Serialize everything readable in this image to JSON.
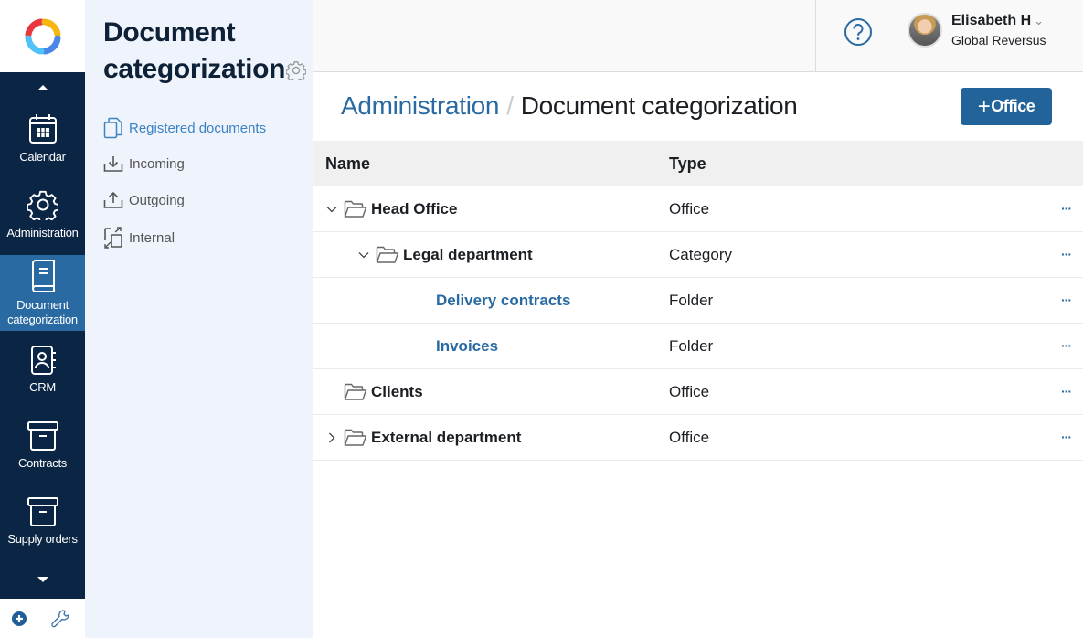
{
  "nav": {
    "items": [
      {
        "label": "Calendar",
        "icon": "calendar-icon"
      },
      {
        "label": "Administration",
        "icon": "gear-icon"
      },
      {
        "label": "Document categorization",
        "icon": "book-icon",
        "active": true
      },
      {
        "label": "CRM",
        "icon": "contact-book-icon"
      },
      {
        "label": "Contracts",
        "icon": "archive-box-icon"
      },
      {
        "label": "Supply orders",
        "icon": "archive-box-icon"
      }
    ]
  },
  "sidebar": {
    "title": "Document categorization",
    "links": [
      {
        "label": "Registered documents",
        "icon": "documents-icon",
        "active": true
      },
      {
        "label": "Incoming",
        "icon": "inbox-download-icon"
      },
      {
        "label": "Outgoing",
        "icon": "outbox-upload-icon"
      },
      {
        "label": "Internal",
        "icon": "internal-transfer-icon"
      }
    ]
  },
  "header": {
    "user_name": "Elisabeth H",
    "user_org": "Global Reversus"
  },
  "page": {
    "breadcrumb_parent": "Administration",
    "breadcrumb_separator": "/",
    "breadcrumb_current": "Document categorization",
    "add_button_plus": "+",
    "add_button_label": "Office"
  },
  "table": {
    "columns": {
      "name": "Name",
      "type": "Type"
    },
    "rows": [
      {
        "name": "Head Office",
        "type": "Office",
        "level": 0,
        "expand": "expanded",
        "folder": true,
        "link": false
      },
      {
        "name": "Legal department",
        "type": "Category",
        "level": 1,
        "expand": "expanded",
        "folder": true,
        "link": false
      },
      {
        "name": "Delivery contracts",
        "type": "Folder",
        "level": 2,
        "expand": "none",
        "folder": false,
        "link": true
      },
      {
        "name": "Invoices",
        "type": "Folder",
        "level": 2,
        "expand": "none",
        "folder": false,
        "link": true
      },
      {
        "name": "Clients",
        "type": "Office",
        "level": 0,
        "expand": "none",
        "folder": true,
        "link": false
      },
      {
        "name": "External department",
        "type": "Office",
        "level": 0,
        "expand": "collapsed",
        "folder": true,
        "link": false
      }
    ],
    "more_label": "···"
  },
  "colors": {
    "nav_bg": "#0b2544",
    "nav_active": "#2a6aa3",
    "accent": "#226399",
    "link": "#2a6aa3",
    "sidebar_bg": "#eff4fc"
  }
}
